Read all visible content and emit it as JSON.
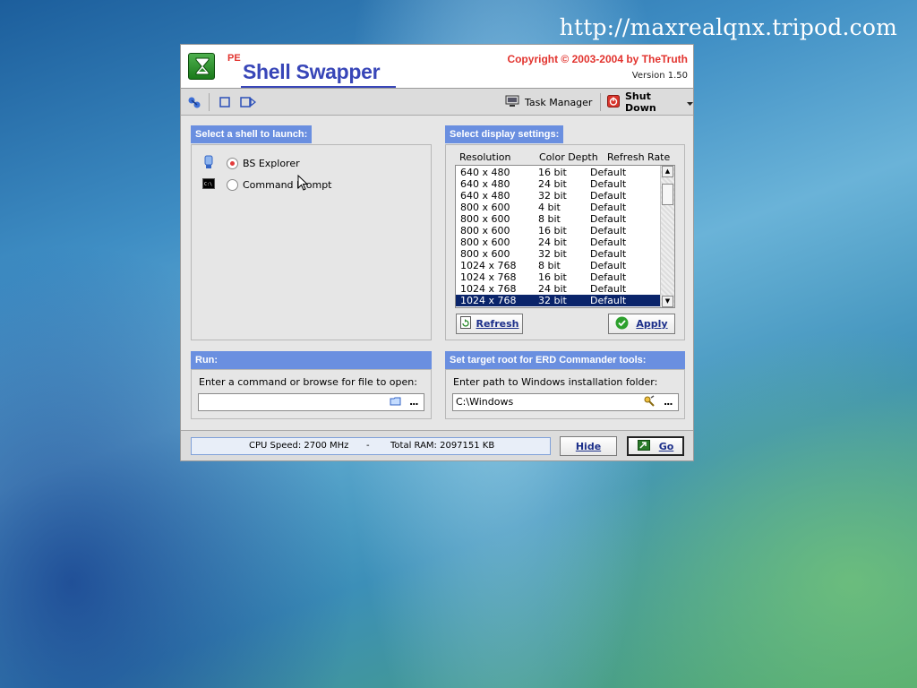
{
  "watermark": "http://maxrealqnx.tripod.com",
  "window": {
    "pe_label": "PE",
    "title": "Shell Swapper",
    "copyright": "Copyright © 2003-2004 by TheTruth",
    "version": "Version 1.50"
  },
  "toolbar": {
    "task_manager": "Task Manager",
    "shut_down": "Shut Down",
    "icons": [
      "network-icon",
      "stop-icon",
      "next-icon",
      "task-manager-icon",
      "power-icon",
      "dropdown-arrow-icon"
    ]
  },
  "shell_panel": {
    "header": "Select a shell to launch:",
    "options": [
      {
        "label": "BS Explorer",
        "selected": true
      },
      {
        "label": "Command Prompt",
        "selected": false
      }
    ]
  },
  "display_panel": {
    "header": "Select display settings:",
    "columns": [
      "Resolution",
      "Color Depth",
      "Refresh Rate"
    ],
    "rows": [
      [
        "640 x 480",
        "16 bit",
        "Default"
      ],
      [
        "640 x 480",
        "24 bit",
        "Default"
      ],
      [
        "640 x 480",
        "32 bit",
        "Default"
      ],
      [
        "800 x 600",
        "4 bit",
        "Default"
      ],
      [
        "800 x 600",
        "8 bit",
        "Default"
      ],
      [
        "800 x 600",
        "16 bit",
        "Default"
      ],
      [
        "800 x 600",
        "24 bit",
        "Default"
      ],
      [
        "800 x 600",
        "32 bit",
        "Default"
      ],
      [
        "1024 x 768",
        "8 bit",
        "Default"
      ],
      [
        "1024 x 768",
        "16 bit",
        "Default"
      ],
      [
        "1024 x 768",
        "24 bit",
        "Default"
      ],
      [
        "1024 x 768",
        "32 bit",
        "Default"
      ]
    ],
    "selected_index": 11,
    "refresh": "Refresh",
    "apply": "Apply"
  },
  "run_panel": {
    "header": "Run:",
    "label": "Enter a command or browse for file to open:",
    "value": "",
    "browse": "..."
  },
  "erd_panel": {
    "header": "Set target root for ERD Commander tools:",
    "label": "Enter path to Windows installation folder:",
    "value": "C:\\Windows",
    "browse": "..."
  },
  "status": {
    "cpu": "CPU Speed: 2700 MHz",
    "separator": "-",
    "ram": "Total RAM: 2097151 KB",
    "hide": "Hide",
    "go": "Go"
  },
  "colors": {
    "panel_header": "#6a8fe0",
    "title_blue": "#3846b8",
    "copyright_red": "#e2332e",
    "selection": "#0a246a"
  }
}
